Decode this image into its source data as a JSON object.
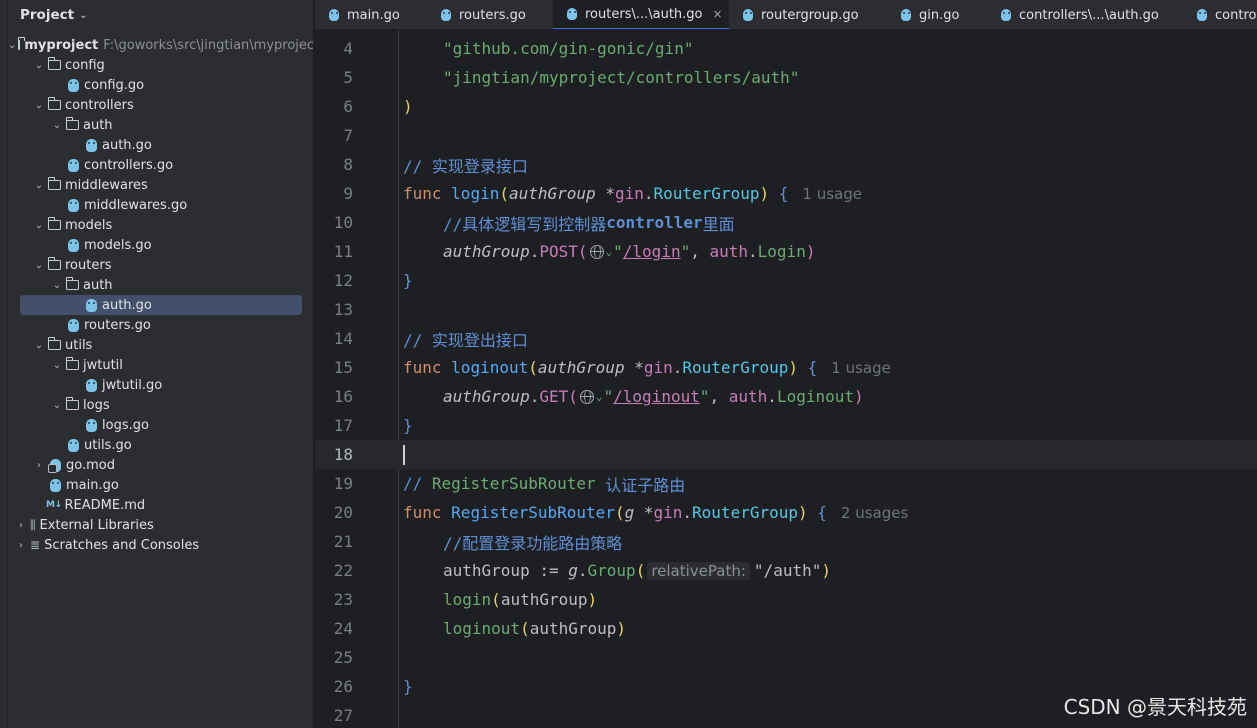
{
  "project": {
    "title": "Project",
    "tree": [
      {
        "label": "myproject",
        "path": "F:\\goworks\\src\\jingtian\\myproject",
        "type": "folder",
        "depth": 0,
        "expanded": true,
        "bold": true
      },
      {
        "label": "config",
        "type": "folder",
        "depth": 1,
        "expanded": true
      },
      {
        "label": "config.go",
        "type": "go",
        "depth": 2
      },
      {
        "label": "controllers",
        "type": "folder",
        "depth": 1,
        "expanded": true
      },
      {
        "label": "auth",
        "type": "folder",
        "depth": 2,
        "expanded": true
      },
      {
        "label": "auth.go",
        "type": "go",
        "depth": 3
      },
      {
        "label": "controllers.go",
        "type": "go",
        "depth": 2
      },
      {
        "label": "middlewares",
        "type": "folder",
        "depth": 1,
        "expanded": true
      },
      {
        "label": "middlewares.go",
        "type": "go",
        "depth": 2
      },
      {
        "label": "models",
        "type": "folder",
        "depth": 1,
        "expanded": true
      },
      {
        "label": "models.go",
        "type": "go",
        "depth": 2
      },
      {
        "label": "routers",
        "type": "folder",
        "depth": 1,
        "expanded": true
      },
      {
        "label": "auth",
        "type": "folder",
        "depth": 2,
        "expanded": true
      },
      {
        "label": "auth.go",
        "type": "go",
        "depth": 3,
        "selected": true
      },
      {
        "label": "routers.go",
        "type": "go",
        "depth": 2
      },
      {
        "label": "utils",
        "type": "folder",
        "depth": 1,
        "expanded": true
      },
      {
        "label": "jwtutil",
        "type": "folder",
        "depth": 2,
        "expanded": true
      },
      {
        "label": "jwtutil.go",
        "type": "go",
        "depth": 3
      },
      {
        "label": "logs",
        "type": "folder",
        "depth": 2,
        "expanded": true
      },
      {
        "label": "logs.go",
        "type": "go",
        "depth": 3
      },
      {
        "label": "utils.go",
        "type": "go",
        "depth": 2
      },
      {
        "label": "go.mod",
        "type": "mod",
        "depth": 1,
        "expanded": false
      },
      {
        "label": "main.go",
        "type": "go",
        "depth": 1
      },
      {
        "label": "README.md",
        "type": "md",
        "depth": 1
      },
      {
        "label": "External Libraries",
        "type": "lib",
        "depth": 0,
        "expanded": false
      },
      {
        "label": "Scratches and Consoles",
        "type": "scratch",
        "depth": 0,
        "expanded": false
      }
    ]
  },
  "tabs": [
    {
      "label": "main.go"
    },
    {
      "label": "routers.go"
    },
    {
      "label": "routers\\...\\auth.go",
      "active": true,
      "close": "×"
    },
    {
      "label": "routergroup.go"
    },
    {
      "label": "gin.go"
    },
    {
      "label": "controllers\\...\\auth.go"
    },
    {
      "label": "contro"
    }
  ],
  "editor": {
    "current_line": 18,
    "lines": [
      {
        "n": "4",
        "indent": 1,
        "t": [
          [
            "c-str",
            "\"github.com/gin-gonic/gin\""
          ]
        ]
      },
      {
        "n": "5",
        "indent": 1,
        "t": [
          [
            "c-str",
            "\"jingtian/myproject/controllers/auth\""
          ]
        ]
      },
      {
        "n": "6",
        "indent": 0,
        "t": [
          [
            "c-br1",
            ")"
          ]
        ]
      },
      {
        "n": "7",
        "indent": 0,
        "t": []
      },
      {
        "n": "8",
        "indent": 0,
        "t": [
          [
            "c-cmt",
            "// 实现登录接口"
          ]
        ]
      },
      {
        "n": "9",
        "indent": 0,
        "t": [
          [
            "c-kw",
            "func "
          ],
          [
            "c-fn",
            "login"
          ],
          [
            "c-br1",
            "("
          ],
          [
            "c-ital",
            "authGroup "
          ],
          [
            "c-pun",
            "*"
          ],
          [
            "c-pkg",
            "gin"
          ],
          [
            "c-pun",
            "."
          ],
          [
            "c-type",
            "RouterGroup"
          ],
          [
            "c-br1",
            ")"
          ],
          [
            "c-pun",
            " "
          ],
          [
            "c-br3",
            "{"
          ],
          [
            "c-hint",
            "1 usage"
          ]
        ]
      },
      {
        "n": "10",
        "indent": 1,
        "t": [
          [
            "c-cmt",
            "//具体逻辑写到控制器"
          ],
          [
            "c-cmt-b",
            "controller"
          ],
          [
            "c-cmt",
            "里面"
          ]
        ]
      },
      {
        "n": "11",
        "indent": 1,
        "t": [
          [
            "c-ital",
            "authGroup"
          ],
          [
            "c-pun",
            "."
          ],
          [
            "c-pkg",
            "POST"
          ],
          [
            "c-br2",
            "("
          ],
          [
            "globe",
            ""
          ],
          [
            "c-str",
            "\""
          ],
          [
            "c-url",
            "/login"
          ],
          [
            "c-str",
            "\""
          ],
          [
            "c-pun",
            ", "
          ],
          [
            "c-pkg",
            "auth"
          ],
          [
            "c-pun",
            "."
          ],
          [
            "c-str",
            "Login"
          ],
          [
            "c-br2",
            ")"
          ]
        ]
      },
      {
        "n": "12",
        "indent": 0,
        "t": [
          [
            "c-br3",
            "}"
          ]
        ]
      },
      {
        "n": "13",
        "indent": 0,
        "t": []
      },
      {
        "n": "14",
        "indent": 0,
        "t": [
          [
            "c-cmt",
            "// 实现登出接口"
          ]
        ]
      },
      {
        "n": "15",
        "indent": 0,
        "t": [
          [
            "c-kw",
            "func "
          ],
          [
            "c-fn",
            "loginout"
          ],
          [
            "c-br1",
            "("
          ],
          [
            "c-ital",
            "authGroup "
          ],
          [
            "c-pun",
            "*"
          ],
          [
            "c-pkg",
            "gin"
          ],
          [
            "c-pun",
            "."
          ],
          [
            "c-type",
            "RouterGroup"
          ],
          [
            "c-br1",
            ")"
          ],
          [
            "c-pun",
            " "
          ],
          [
            "c-br3",
            "{"
          ],
          [
            "c-hint",
            "1 usage"
          ]
        ]
      },
      {
        "n": "16",
        "indent": 1,
        "t": [
          [
            "c-ital",
            "authGroup"
          ],
          [
            "c-pun",
            "."
          ],
          [
            "c-pkg",
            "GET"
          ],
          [
            "c-br2",
            "("
          ],
          [
            "globe",
            ""
          ],
          [
            "c-str",
            "\""
          ],
          [
            "c-url",
            "/loginout"
          ],
          [
            "c-str",
            "\""
          ],
          [
            "c-pun",
            ", "
          ],
          [
            "c-pkg",
            "auth"
          ],
          [
            "c-pun",
            "."
          ],
          [
            "c-str",
            "Loginout"
          ],
          [
            "c-br2",
            ")"
          ]
        ]
      },
      {
        "n": "17",
        "indent": 0,
        "t": [
          [
            "c-br3",
            "}"
          ]
        ]
      },
      {
        "n": "18",
        "indent": 0,
        "t": [
          [
            "caret",
            ""
          ]
        ]
      },
      {
        "n": "19",
        "indent": 0,
        "t": [
          [
            "c-cmt",
            "// "
          ],
          [
            "c-str",
            "RegisterSubRouter"
          ],
          [
            "c-cmt",
            " 认证子路由"
          ]
        ]
      },
      {
        "n": "20",
        "indent": 0,
        "t": [
          [
            "c-kw",
            "func "
          ],
          [
            "c-fn",
            "RegisterSubRouter"
          ],
          [
            "c-br1",
            "("
          ],
          [
            "c-ital",
            "g "
          ],
          [
            "c-pun",
            "*"
          ],
          [
            "c-pkg",
            "gin"
          ],
          [
            "c-pun",
            "."
          ],
          [
            "c-type",
            "RouterGroup"
          ],
          [
            "c-br1",
            ")"
          ],
          [
            "c-pun",
            " "
          ],
          [
            "c-br3",
            "{"
          ],
          [
            "c-hint",
            "2 usages"
          ]
        ]
      },
      {
        "n": "21",
        "indent": 1,
        "t": [
          [
            "c-cmt",
            "//配置登录功能路由策略"
          ]
        ]
      },
      {
        "n": "22",
        "indent": 1,
        "t": [
          [
            "c-var",
            "authGroup := "
          ],
          [
            "c-ital",
            "g"
          ],
          [
            "c-pun",
            "."
          ],
          [
            "c-str",
            "Group"
          ],
          [
            "c-br1",
            "("
          ],
          [
            "c-inlay",
            "relativePath:"
          ],
          [
            "c-var",
            "\"/auth\""
          ],
          [
            "c-br1",
            ")"
          ]
        ]
      },
      {
        "n": "23",
        "indent": 1,
        "t": [
          [
            "c-str",
            "login"
          ],
          [
            "c-br1",
            "("
          ],
          [
            "c-var",
            "authGroup"
          ],
          [
            "c-br1",
            ")"
          ]
        ]
      },
      {
        "n": "24",
        "indent": 1,
        "t": [
          [
            "c-str",
            "loginout"
          ],
          [
            "c-br1",
            "("
          ],
          [
            "c-var",
            "authGroup"
          ],
          [
            "c-br1",
            ")"
          ]
        ]
      },
      {
        "n": "25",
        "indent": 0,
        "t": []
      },
      {
        "n": "26",
        "indent": 0,
        "t": [
          [
            "c-br3",
            "}"
          ]
        ]
      },
      {
        "n": "27",
        "indent": 0,
        "t": []
      }
    ]
  },
  "watermark": "CSDN @景天科技苑"
}
